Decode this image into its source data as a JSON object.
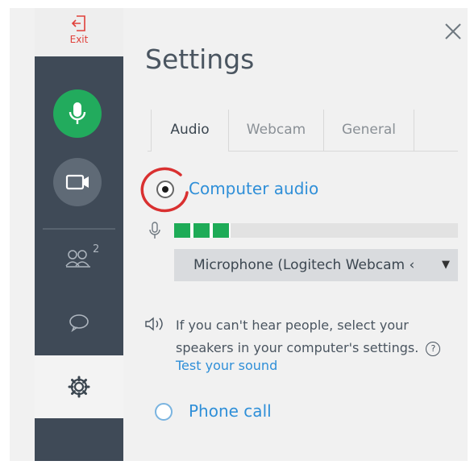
{
  "rail": {
    "exit_label": "Exit",
    "participants_count": "2",
    "icons": [
      "exit-icon",
      "microphone-icon",
      "webcam-icon",
      "participants-icon",
      "chat-icon",
      "gear-icon"
    ]
  },
  "panel": {
    "title": "Settings",
    "tabs": [
      {
        "label": "Audio",
        "active": true
      },
      {
        "label": "Webcam",
        "active": false
      },
      {
        "label": "General",
        "active": false
      }
    ],
    "options": {
      "computer_audio": "Computer audio",
      "phone_call": "Phone call",
      "selected": "computer_audio"
    },
    "mic_level_fraction": 0.2,
    "microphone_device": "Microphone (Logitech Webcam ‹",
    "help_text": "If you can't hear people, select your speakers in your computer's settings.",
    "help_symbol": "?",
    "test_link": "Test your sound"
  },
  "colors": {
    "accent_blue": "#2f8fd8",
    "mic_green": "#22ab5d",
    "rail_dark": "#3f4a57",
    "exit_red": "#e0403a",
    "highlight_ring": "#d93030"
  }
}
